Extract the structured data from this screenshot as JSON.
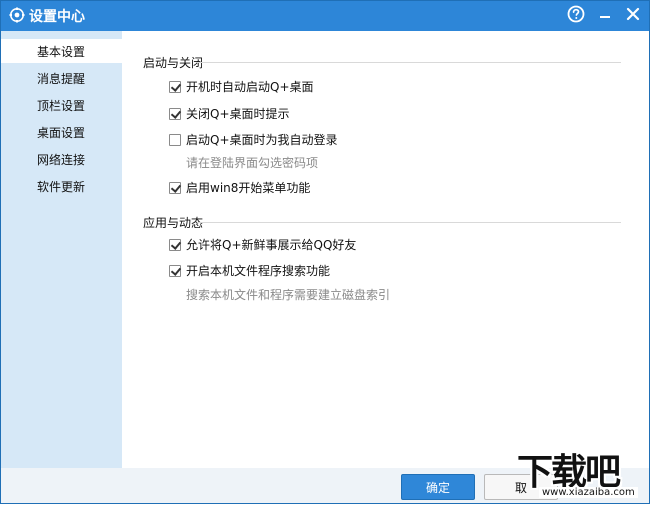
{
  "window": {
    "title": "设置中心",
    "buttons": {
      "help_icon": "help-circle-icon",
      "min_icon": "minimize-icon",
      "close_icon": "close-icon"
    },
    "accent": "#2d86d8"
  },
  "sidebar": {
    "items": [
      {
        "label": "基本设置",
        "selected": true
      },
      {
        "label": "消息提醒",
        "selected": false
      },
      {
        "label": "顶栏设置",
        "selected": false
      },
      {
        "label": "桌面设置",
        "selected": false
      },
      {
        "label": "网络连接",
        "selected": false
      },
      {
        "label": "软件更新",
        "selected": false
      }
    ],
    "bg": "#d6e8f7"
  },
  "sections": {
    "startup": {
      "title": "启动与关闭",
      "options": [
        {
          "label": "开机时自动启动Q+桌面",
          "checked": true
        },
        {
          "label": "关闭Q+桌面时提示",
          "checked": true
        },
        {
          "label": "启动Q+桌面时为我自动登录",
          "checked": false,
          "hint": "请在登陆界面勾选密码项"
        },
        {
          "label": "启用win8开始菜单功能",
          "checked": true
        }
      ]
    },
    "apps": {
      "title": "应用与动态",
      "options": [
        {
          "label": "允许将Q+新鲜事展示给QQ好友",
          "checked": true
        },
        {
          "label": "开启本机文件程序搜索功能",
          "checked": true,
          "hint": "搜索本机文件和程序需要建立磁盘索引"
        }
      ]
    }
  },
  "footer": {
    "ok_label": "确定",
    "cancel_label": "取"
  },
  "watermark": {
    "text": "下载吧",
    "url": "www.xiazaiba.com"
  }
}
